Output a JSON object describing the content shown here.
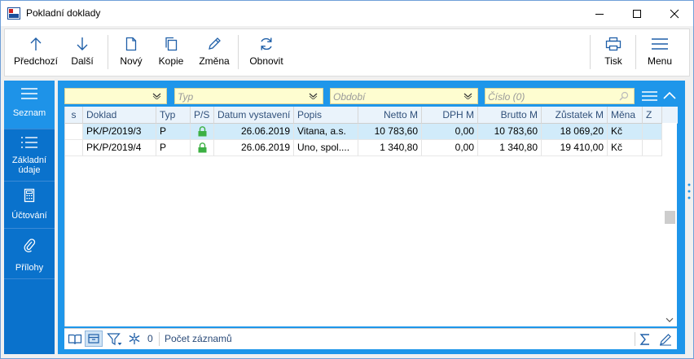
{
  "window": {
    "title": "Pokladní doklady",
    "accent": "#0a72cc"
  },
  "toolbar": {
    "prev_label": "Předchozí",
    "next_label": "Další",
    "new_label": "Nový",
    "copy_label": "Kopie",
    "edit_label": "Změna",
    "refresh_label": "Obnovit",
    "print_label": "Tisk",
    "menu_label": "Menu"
  },
  "sidebar": {
    "items": [
      {
        "label": "Seznam",
        "icon": "list-icon",
        "active": true
      },
      {
        "label": "Základní údaje",
        "icon": "details-icon"
      },
      {
        "label": "Účtování",
        "icon": "calculator-icon"
      },
      {
        "label": "Přílohy",
        "icon": "paperclip-icon"
      }
    ]
  },
  "filters": {
    "first_value": "",
    "type_placeholder": "Typ",
    "period_placeholder": "Období",
    "number_placeholder": "Číslo (0)"
  },
  "table": {
    "columns": [
      "s",
      "Doklad",
      "Typ",
      "P/S",
      "Datum vystavení",
      "Popis",
      "Netto M",
      "DPH M",
      "Brutto M",
      "Zůstatek M",
      "Měna",
      "Z"
    ],
    "rows": [
      {
        "s": "",
        "doklad": "PK/P/2019/3",
        "typ": "P",
        "ps": "lock",
        "datum": "26.06.2019",
        "popis": "Vitana, a.s.",
        "netto": "10 783,60",
        "dph": "0,00",
        "brutto": "10 783,60",
        "zustatek": "18 069,20",
        "mena": "Kč",
        "z": "",
        "selected": true
      },
      {
        "s": "",
        "doklad": "PK/P/2019/4",
        "typ": "P",
        "ps": "lock",
        "datum": "26.06.2019",
        "popis": "Uno, spol....",
        "netto": "1 340,80",
        "dph": "0,00",
        "brutto": "1 340,80",
        "zustatek": "19 410,00",
        "mena": "Kč",
        "z": ""
      }
    ]
  },
  "statusbar": {
    "filter_count": "0",
    "record_count_label": "Počet záznamů"
  }
}
